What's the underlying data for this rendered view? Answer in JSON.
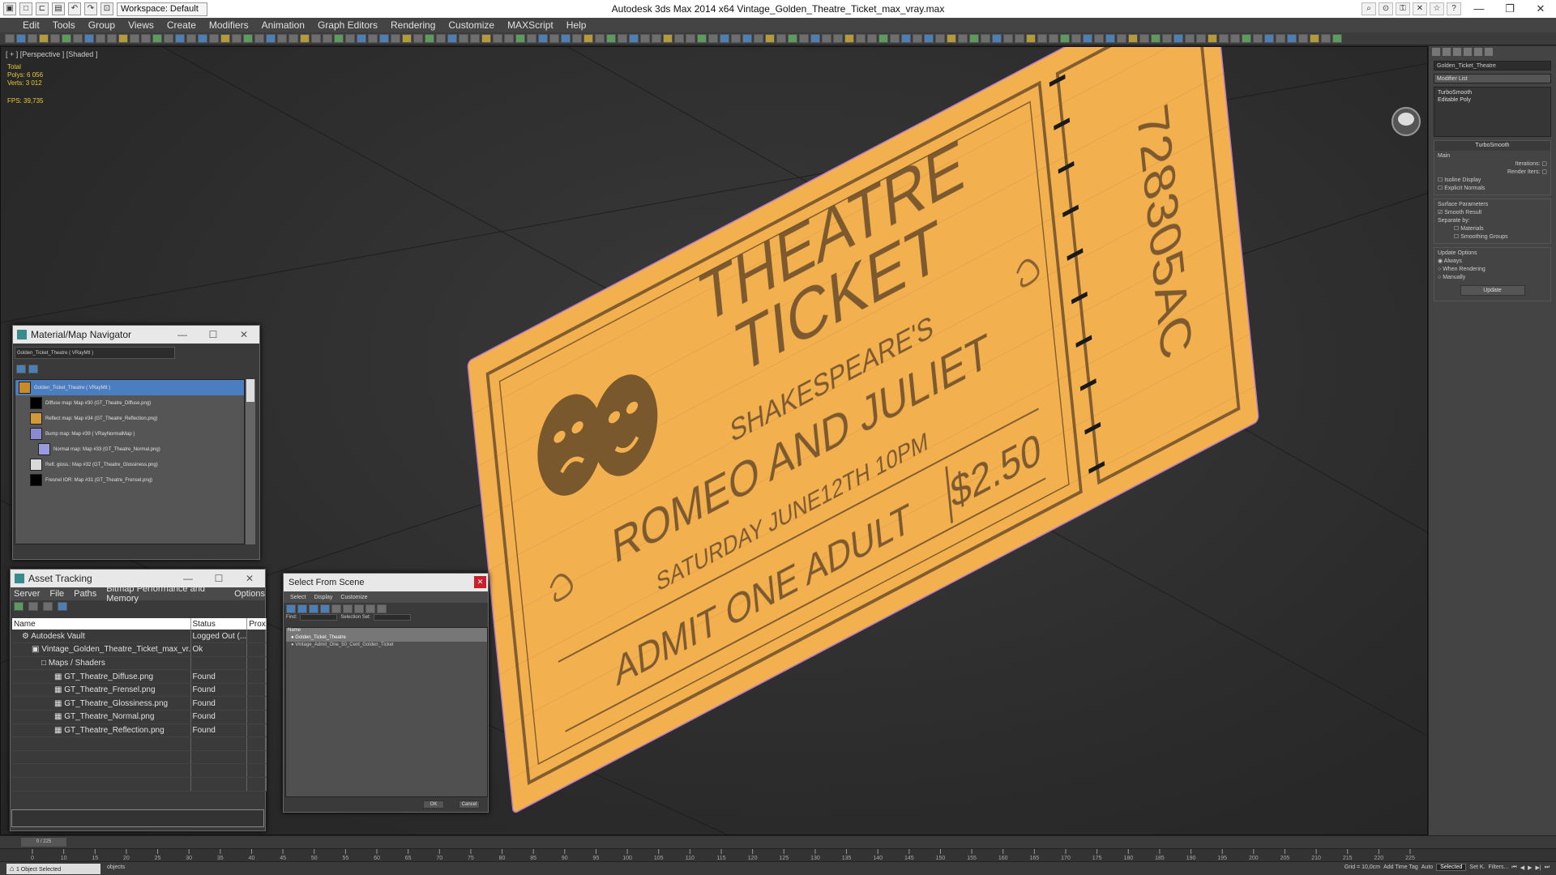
{
  "app": {
    "window_title": "Autodesk 3ds Max  2014 x64     Vintage_Golden_Theatre_Ticket_max_vray.max",
    "workspace": "Workspace: Default"
  },
  "menus": [
    "Edit",
    "Tools",
    "Group",
    "Views",
    "Create",
    "Modifiers",
    "Animation",
    "Graph Editors",
    "Rendering",
    "Customize",
    "MAXScript",
    "Help"
  ],
  "viewport": {
    "label": "[ + ] [Perspective ] [Shaded ]",
    "stats": {
      "total": "Total",
      "polys_label": "Polys:",
      "polys": "6 056",
      "verts_label": "Verts:",
      "verts": "3 012",
      "fps_label": "FPS:",
      "fps": "39,735"
    },
    "ticket": {
      "heading1": "THEATRE",
      "heading2": "TICKET",
      "author": "SHAKESPEARE'S",
      "play": "ROMEO AND JULIET",
      "date": "SATURDAY   JUNE12TH 10PM",
      "admit": "ADMIT ONE ADULT",
      "price": "$2.50",
      "serial": "728305AC",
      "paper_color": "#f3b04f",
      "ink_color": "#6e4f2a"
    }
  },
  "command_panel": {
    "object_name": "Golden_Ticket_Theatre",
    "modifier_list": "Modifier List",
    "stack": [
      "TurboSmooth",
      "Editable Poly"
    ],
    "rollout_title": "TurboSmooth",
    "main": "Main",
    "iterations": "Iterations:",
    "render_iters": "Render Iters:",
    "isoline": "Isoline Display",
    "explicit_normals": "Explicit Normals",
    "surface_params": "Surface Parameters",
    "smooth_result": "Smooth Result",
    "separate_by": "Separate by:",
    "materials": "Materials",
    "smoothing_groups": "Smoothing Groups",
    "update_options": "Update Options",
    "always": "Always",
    "when_rendering": "When Rendering",
    "manually": "Manually",
    "update_button": "Update"
  },
  "material_navigator": {
    "title": "Material/Map Navigator",
    "path": "Golden_Ticket_Theatre ( VRayMtl )",
    "items": [
      {
        "label": "Golden_Ticket_Theatre  ( VRayMtl )",
        "swatch": "#c98a2a"
      },
      {
        "label": "Diffuse map: Map #30 (GT_Theatre_Diffuse.png)",
        "swatch": "#000000"
      },
      {
        "label": "Reflect map: Map #34 (GT_Theatre_Reflection.png)",
        "swatch": "#d09a3a"
      },
      {
        "label": "Bump map: Map #39  ( VRayNormalMap )",
        "swatch": "#8a8ad0"
      },
      {
        "label": "Normal map: Map #33 (GT_Theatre_Normal.png)",
        "swatch": "#9a9ae0"
      },
      {
        "label": "Refl. gloss.: Map #32 (GT_Theatre_Glossiness.png)",
        "swatch": "#d8d8d8"
      },
      {
        "label": "Fresnel IOR: Map #31 (GT_Theatre_Frensel.png)",
        "swatch": "#000000"
      }
    ]
  },
  "asset_tracking": {
    "title": "Asset Tracking",
    "menu": [
      "Server",
      "File",
      "Paths",
      "Bitmap Performance and Memory",
      "Options"
    ],
    "columns": [
      "Name",
      "Status",
      "Prox"
    ],
    "rows": [
      {
        "name": "Autodesk Vault",
        "status": "Logged Out (..."
      },
      {
        "name": "Vintage_Golden_Theatre_Ticket_max_vr...",
        "status": "Ok"
      },
      {
        "name": "Maps / Shaders",
        "status": ""
      },
      {
        "name": "GT_Theatre_Diffuse.png",
        "status": "Found"
      },
      {
        "name": "GT_Theatre_Frensel.png",
        "status": "Found"
      },
      {
        "name": "GT_Theatre_Glossiness.png",
        "status": "Found"
      },
      {
        "name": "GT_Theatre_Normal.png",
        "status": "Found"
      },
      {
        "name": "GT_Theatre_Reflection.png",
        "status": "Found"
      }
    ]
  },
  "select_scene": {
    "title": "Select From Scene",
    "menu": [
      "Select",
      "Display",
      "Customize"
    ],
    "find": "Find:",
    "selection_set": "Selection Set:",
    "header": "Name",
    "items": [
      "Golden_Ticket_Theatre",
      "Vintage_Admit_One_50_Cent_Golden_Ticket"
    ],
    "ok": "OK",
    "cancel": "Cancel"
  },
  "timeline": {
    "frame": "0 / 225"
  },
  "ruler_ticks": [
    "0",
    "10",
    "15",
    "20",
    "25",
    "30",
    "35",
    "40",
    "45",
    "50",
    "55",
    "60",
    "65",
    "70",
    "75",
    "80",
    "85",
    "90",
    "95",
    "100",
    "105",
    "110",
    "115",
    "120",
    "125",
    "130",
    "135",
    "140",
    "145",
    "150",
    "155",
    "160",
    "165",
    "170",
    "175",
    "180",
    "185",
    "190",
    "195",
    "200",
    "205",
    "210",
    "215",
    "220",
    "225"
  ],
  "status": {
    "prompt": "1 Object Selected",
    "grid": "Grid = 10,0cm",
    "auto": "Auto",
    "selected": "Selected",
    "set_key": "Set K.",
    "filters": "Filters...",
    "add_time_tag": "Add Time Tag",
    "objects": "objects"
  }
}
